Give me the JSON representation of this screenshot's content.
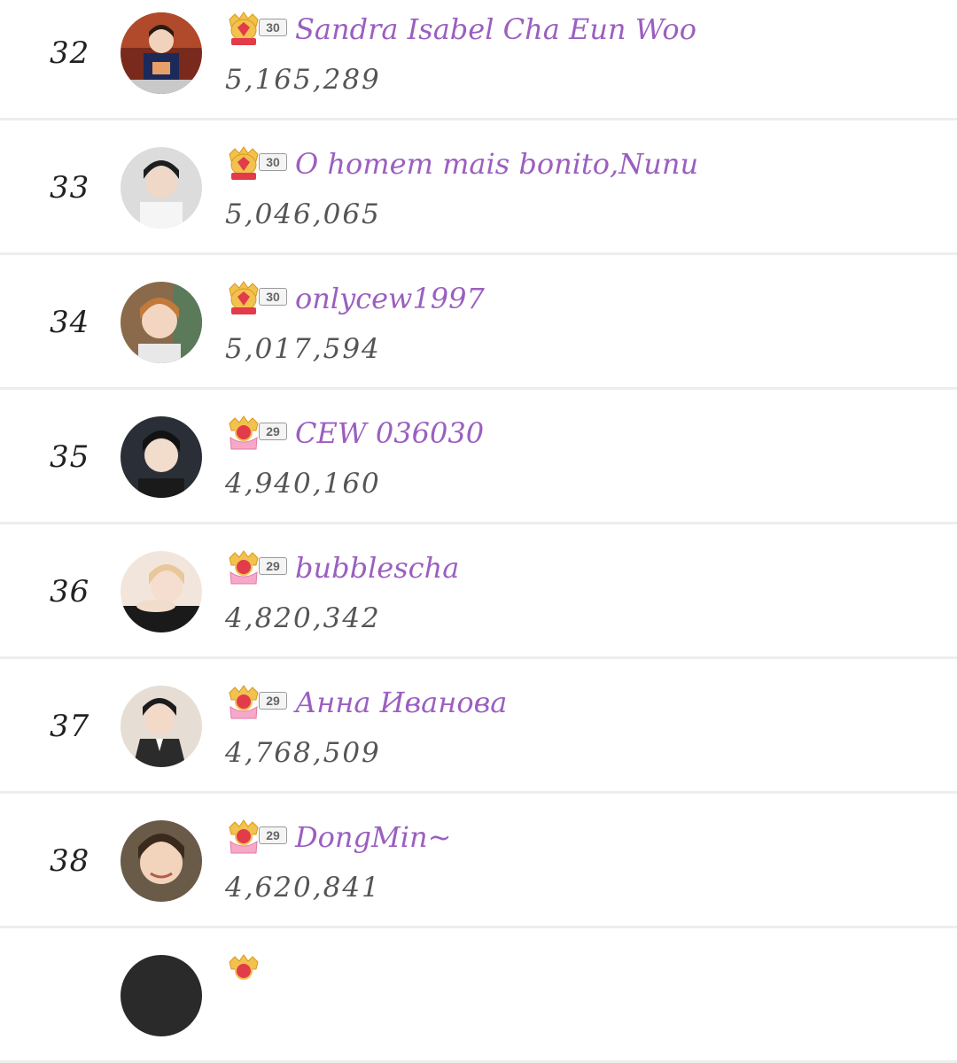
{
  "ranking": {
    "rows": [
      {
        "rank": "32",
        "level": "30",
        "name": "Sandra Isabel Cha Eun Woo",
        "score": "5,165,289",
        "badge_icon": "ruby-crown-icon",
        "avatar_icon": "avatar-photo"
      },
      {
        "rank": "33",
        "level": "30",
        "name": "O homem mais bonito,Nunu",
        "score": "5,046,065",
        "badge_icon": "ruby-crown-icon",
        "avatar_icon": "avatar-photo"
      },
      {
        "rank": "34",
        "level": "30",
        "name": "onlycew1997",
        "score": "5,017,594",
        "badge_icon": "ruby-crown-icon",
        "avatar_icon": "avatar-photo"
      },
      {
        "rank": "35",
        "level": "29",
        "name": "CEW 036030",
        "score": "4,940,160",
        "badge_icon": "pink-crown-icon",
        "avatar_icon": "avatar-photo"
      },
      {
        "rank": "36",
        "level": "29",
        "name": "bubblescha",
        "score": "4,820,342",
        "badge_icon": "pink-crown-icon",
        "avatar_icon": "avatar-photo"
      },
      {
        "rank": "37",
        "level": "29",
        "name": "Анна Иванова",
        "score": "4,768,509",
        "badge_icon": "pink-crown-icon",
        "avatar_icon": "avatar-photo"
      },
      {
        "rank": "38",
        "level": "29",
        "name": "DongMin~",
        "score": "4,620,841",
        "badge_icon": "pink-crown-icon",
        "avatar_icon": "avatar-photo"
      }
    ]
  },
  "colors": {
    "name": "#9b5fc0",
    "score": "#555555",
    "rank": "#222222",
    "divider": "#ededed",
    "crown_gold": "#f2c14e",
    "ruby": "#e23b4a",
    "pink_base": "#f7a8c8"
  }
}
